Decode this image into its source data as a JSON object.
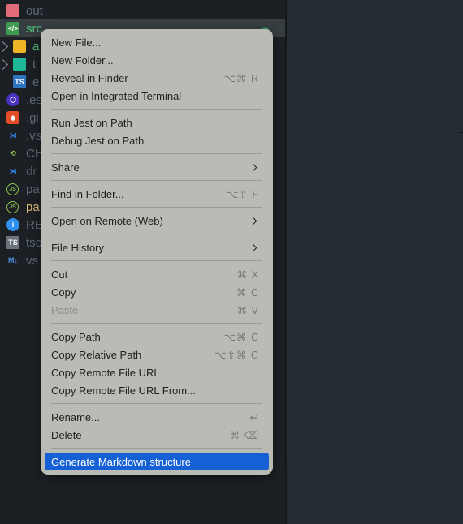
{
  "file_tree": [
    {
      "name": "out",
      "icon": "folder-red-icon",
      "color": "#5d6b78"
    },
    {
      "name": "src",
      "icon": "folder-src-icon",
      "color": "#4fc078",
      "selected": true
    },
    {
      "name": "a",
      "icon": "folder-yellow-icon",
      "color": "#4fc078",
      "expandable": true
    },
    {
      "name": "t",
      "icon": "folder-teal-icon",
      "color": "#5d6b78",
      "expandable": true
    },
    {
      "name": "e",
      "icon": "typescript-file-icon",
      "color": "#5d6b78"
    },
    {
      "name": ".es",
      "icon": "eslint-icon",
      "color": "#5d6b78"
    },
    {
      "name": ".gi",
      "icon": "git-icon",
      "color": "#5d6b78"
    },
    {
      "name": ".vs",
      "icon": "vscode-icon",
      "color": "#5d6b78"
    },
    {
      "name": "CH",
      "icon": "changelog-icon",
      "color": "#5d6b78"
    },
    {
      "name": "dr",
      "icon": "vscode-icon",
      "color": "#4a5560"
    },
    {
      "name": "pa",
      "icon": "nodejs-icon",
      "color": "#5d6b78"
    },
    {
      "name": "pa",
      "icon": "nodejs-icon",
      "color": "#e2c07a"
    },
    {
      "name": "RE",
      "icon": "info-icon",
      "color": "#5d6b78"
    },
    {
      "name": "tsc",
      "icon": "tsconfig-icon",
      "color": "#5d6b78"
    },
    {
      "name": "vs",
      "icon": "markdown-icon",
      "color": "#5d6b78"
    }
  ],
  "context_menu": {
    "groups": [
      [
        {
          "label": "New File..."
        },
        {
          "label": "New Folder..."
        },
        {
          "label": "Reveal in Finder",
          "shortcut": "⌥⌘ R"
        },
        {
          "label": "Open in Integrated Terminal"
        }
      ],
      [
        {
          "label": "Run Jest on Path"
        },
        {
          "label": "Debug Jest on Path"
        }
      ],
      [
        {
          "label": "Share",
          "submenu": true
        }
      ],
      [
        {
          "label": "Find in Folder...",
          "shortcut": "⌥⇧ F"
        }
      ],
      [
        {
          "label": "Open on Remote (Web)",
          "submenu": true
        }
      ],
      [
        {
          "label": "File History",
          "submenu": true
        }
      ],
      [
        {
          "label": "Cut",
          "shortcut": "⌘ X"
        },
        {
          "label": "Copy",
          "shortcut": "⌘ C"
        },
        {
          "label": "Paste",
          "shortcut": "⌘ V",
          "disabled": true
        }
      ],
      [
        {
          "label": "Copy Path",
          "shortcut": "⌥⌘ C"
        },
        {
          "label": "Copy Relative Path",
          "shortcut": "⌥⇧⌘ C"
        },
        {
          "label": "Copy Remote File URL"
        },
        {
          "label": "Copy Remote File URL From..."
        }
      ],
      [
        {
          "label": "Rename...",
          "shortcut": "↩"
        },
        {
          "label": "Delete",
          "shortcut": "⌘ ⌫"
        }
      ],
      [
        {
          "label": "Generate Markdown structure",
          "highlighted": true
        }
      ]
    ]
  },
  "colors": {
    "highlight": "#1560d4",
    "menu_bg": "#bbbbb5",
    "sidebar_bg": "#1c2024",
    "editor_bg": "#252b33"
  }
}
